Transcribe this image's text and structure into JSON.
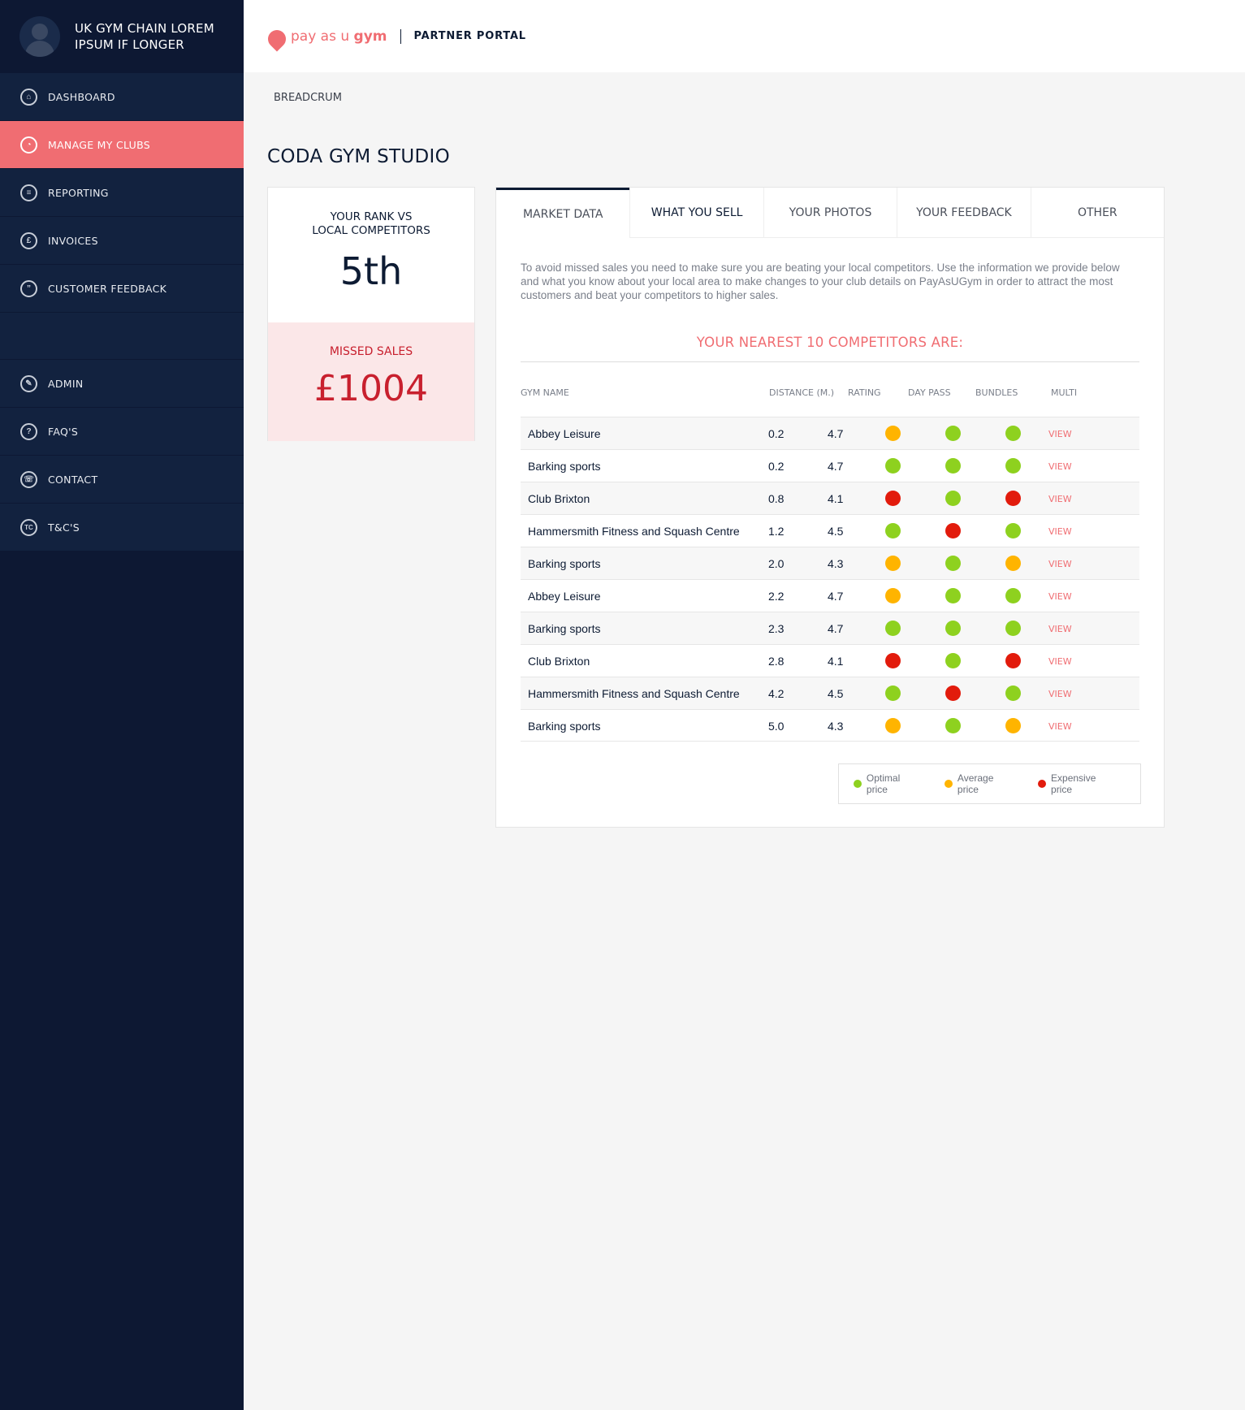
{
  "sidebar": {
    "account_name": "UK GYM CHAIN LOREM IPSUM IF LONGER",
    "items_top": [
      {
        "label": "DASHBOARD",
        "icon": "home-icon",
        "glyph": "⌂"
      },
      {
        "label": "MANAGE MY CLUBS",
        "icon": "gauge-icon",
        "glyph": "◔"
      },
      {
        "label": "REPORTING",
        "icon": "report-icon",
        "glyph": "≡"
      },
      {
        "label": "INVOICES",
        "icon": "pound-icon",
        "glyph": "£"
      },
      {
        "label": "CUSTOMER FEEDBACK",
        "icon": "quote-icon",
        "glyph": "”"
      }
    ],
    "items_bottom": [
      {
        "label": "ADMIN",
        "icon": "pen-icon",
        "glyph": "✎"
      },
      {
        "label": "FAQ'S",
        "icon": "question-icon",
        "glyph": "?"
      },
      {
        "label": "CONTACT",
        "icon": "phone-icon",
        "glyph": "☏"
      },
      {
        "label": "T&C'S",
        "icon": "tc-icon",
        "glyph": "TC"
      }
    ]
  },
  "header": {
    "logo_pay": "pay as u ",
    "logo_gym": "gym",
    "portal": "PARTNER PORTAL"
  },
  "breadcrumb": "BREADCRUM",
  "page_title": "CODA GYM STUDIO",
  "rank": {
    "label_line1": "YOUR RANK VS",
    "label_line2": "LOCAL COMPETITORS",
    "value": "5th"
  },
  "missed": {
    "label": "MISSED SALES",
    "value": "£1004"
  },
  "tabs": [
    "MARKET DATA",
    "WHAT YOU SELL",
    "YOUR PHOTOS",
    "YOUR  FEEDBACK",
    "OTHER"
  ],
  "intro": "To avoid missed sales you need to make sure you are beating your local competitors.  Use the information we provide below and what you know about your local area to make changes to your club details on PayAsUGym in order to attract the most customers and beat your competitors to higher sales.",
  "competitors_heading": "YOUR NEAREST 10 COMPETITORS ARE:",
  "table": {
    "headers": {
      "name": "GYM NAME",
      "distance": "DISTANCE (M.)",
      "rating": "RATING",
      "day_pass": "DAY PASS",
      "bundles": "BUNDLES",
      "multi": "MULTI"
    },
    "view_label": "VIEW",
    "rows": [
      {
        "name": "Abbey Leisure",
        "distance": "0.2",
        "rating": "4.7",
        "day_pass": "average",
        "bundles": "optimal",
        "multi": "optimal"
      },
      {
        "name": "Barking sports",
        "distance": "0.2",
        "rating": "4.7",
        "day_pass": "optimal",
        "bundles": "optimal",
        "multi": "optimal"
      },
      {
        "name": "Club Brixton",
        "distance": "0.8",
        "rating": "4.1",
        "day_pass": "expensive",
        "bundles": "optimal",
        "multi": "expensive"
      },
      {
        "name": "Hammersmith Fitness and Squash Centre",
        "distance": "1.2",
        "rating": "4.5",
        "day_pass": "optimal",
        "bundles": "expensive",
        "multi": "optimal"
      },
      {
        "name": "Barking sports",
        "distance": "2.0",
        "rating": "4.3",
        "day_pass": "average",
        "bundles": "optimal",
        "multi": "average"
      },
      {
        "name": "Abbey Leisure",
        "distance": "2.2",
        "rating": "4.7",
        "day_pass": "average",
        "bundles": "optimal",
        "multi": "optimal"
      },
      {
        "name": "Barking sports",
        "distance": "2.3",
        "rating": "4.7",
        "day_pass": "optimal",
        "bundles": "optimal",
        "multi": "optimal"
      },
      {
        "name": "Club Brixton",
        "distance": "2.8",
        "rating": "4.1",
        "day_pass": "expensive",
        "bundles": "optimal",
        "multi": "expensive"
      },
      {
        "name": "Hammersmith Fitness and Squash Centre",
        "distance": "4.2",
        "rating": "4.5",
        "day_pass": "optimal",
        "bundles": "expensive",
        "multi": "optimal"
      },
      {
        "name": "Barking sports",
        "distance": "5.0",
        "rating": "4.3",
        "day_pass": "average",
        "bundles": "optimal",
        "multi": "average"
      }
    ]
  },
  "legend": {
    "optimal": "Optimal price",
    "average": "Average price",
    "expensive": "Expensive price"
  },
  "colors": {
    "optimal": "#8ed11f",
    "average": "#ffb400",
    "expensive": "#e21b0c",
    "accent": "#f06d72",
    "navy": "#0d1833"
  }
}
